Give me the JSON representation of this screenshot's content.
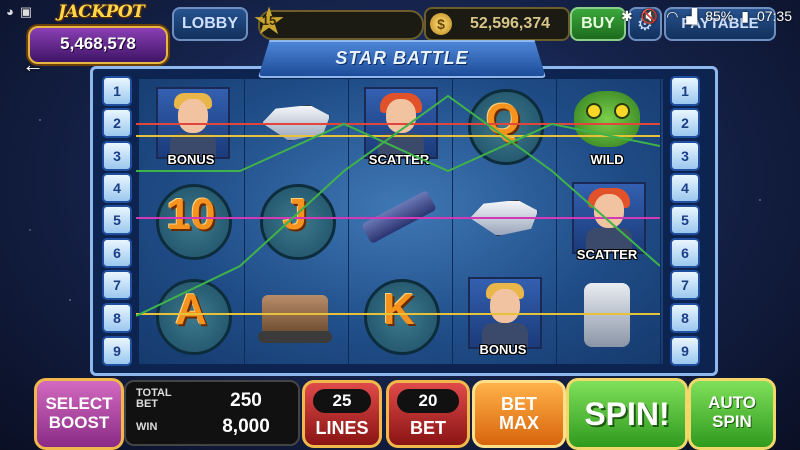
{
  "status_bar": {
    "battery": "85%",
    "time": "07:35"
  },
  "jackpot": {
    "title": "JACKPOT",
    "value": "5,468,578"
  },
  "top": {
    "lobby": "LOBBY",
    "level": "15",
    "coins": "52,596,374",
    "coin_symbol": "$",
    "buy": "BUY",
    "paytable": "PAYTABLE"
  },
  "game_title": "STAR BATTLE",
  "line_numbers": [
    "1",
    "2",
    "3",
    "4",
    "5",
    "6",
    "7",
    "8",
    "9"
  ],
  "reels": [
    [
      {
        "type": "portrait-blonde",
        "label": "BONUS"
      },
      {
        "type": "letter",
        "label": "10"
      },
      {
        "type": "letter",
        "label": "A"
      }
    ],
    [
      {
        "type": "ship",
        "label": ""
      },
      {
        "type": "letter",
        "label": "J"
      },
      {
        "type": "tank",
        "label": ""
      }
    ],
    [
      {
        "type": "portrait-red",
        "label": "SCATTER"
      },
      {
        "type": "gun",
        "label": ""
      },
      {
        "type": "letter",
        "label": "K"
      }
    ],
    [
      {
        "type": "letter",
        "label": "Q"
      },
      {
        "type": "ship",
        "label": ""
      },
      {
        "type": "portrait-blonde",
        "label": "BONUS"
      }
    ],
    [
      {
        "type": "frog",
        "label": "WILD"
      },
      {
        "type": "portrait-red",
        "label": "SCATTER"
      },
      {
        "type": "robot",
        "label": ""
      }
    ]
  ],
  "controls": {
    "select_boost_1": "SELECT",
    "select_boost_2": "BOOST",
    "total_bet_label_1": "TOTAL",
    "total_bet_label_2": "BET",
    "total_bet": "250",
    "win_label": "WIN",
    "win": "8,000",
    "lines_value": "25",
    "lines_label": "LINES",
    "bet_value": "20",
    "bet_label": "BET",
    "bet_max_1": "BET",
    "bet_max_2": "MAX",
    "spin": "SPIN!",
    "auto_1": "AUTO",
    "auto_2": "SPIN"
  },
  "colors": {
    "payline_red": "#e0463c",
    "payline_yellow": "#e6c23a",
    "payline_green": "#3fb24a",
    "payline_magenta": "#d43ab8"
  }
}
